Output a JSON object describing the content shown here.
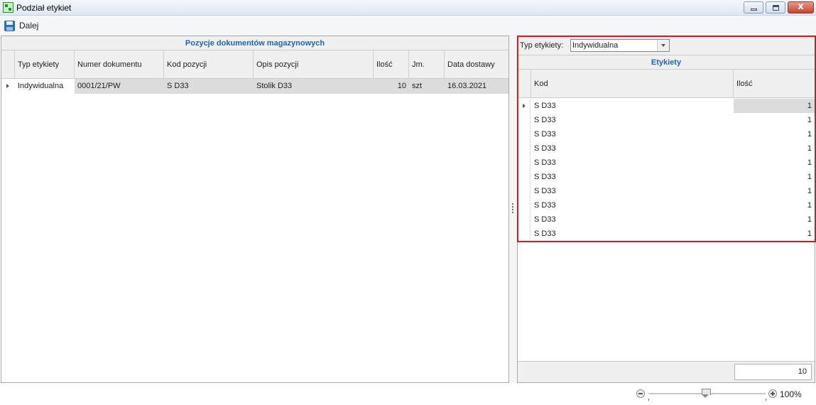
{
  "window": {
    "title": "Podział etykiet",
    "icon": "label-split-app-icon",
    "controls": [
      "minimize-icon",
      "maximize-icon",
      "close-icon"
    ],
    "close_glyph": "x"
  },
  "toolbar": {
    "dalej_label": "Dalej",
    "dalej_icon": "save-icon"
  },
  "left_panel": {
    "title": "Pozycje dokumentów magazynowych",
    "columns": [
      "Typ etykiety",
      "Numer dokumentu",
      "Kod pozycji",
      "Opis pozycji",
      "Ilość",
      "Jm.",
      "Data dostawy"
    ],
    "rows": [
      {
        "typ_etykiety": "Indywidualna",
        "numer_dokumentu": "0001/21/PW",
        "kod_pozycji": "S D33",
        "opis_pozycji": "Stolik D33",
        "ilosc": "10",
        "jm": "szt",
        "data_dostawy": "16.03.2021"
      }
    ]
  },
  "right_panel": {
    "type_label": "Typ etykiety:",
    "type_value": "Indywidualna",
    "title": "Etykiety",
    "columns": [
      "Kod",
      "Ilość"
    ],
    "rows": [
      {
        "kod": "S D33",
        "ilosc": "1"
      },
      {
        "kod": "S D33",
        "ilosc": "1"
      },
      {
        "kod": "S D33",
        "ilosc": "1"
      },
      {
        "kod": "S D33",
        "ilosc": "1"
      },
      {
        "kod": "S D33",
        "ilosc": "1"
      },
      {
        "kod": "S D33",
        "ilosc": "1"
      },
      {
        "kod": "S D33",
        "ilosc": "1"
      },
      {
        "kod": "S D33",
        "ilosc": "1"
      },
      {
        "kod": "S D33",
        "ilosc": "1"
      },
      {
        "kod": "S D33",
        "ilosc": "1"
      }
    ],
    "sum": "10"
  },
  "statusbar": {
    "zoom_label": "100%"
  },
  "colors": {
    "accent": "#1e64b4",
    "highlight_border": "#e0141e",
    "selected_row": "#dcdcdc"
  }
}
